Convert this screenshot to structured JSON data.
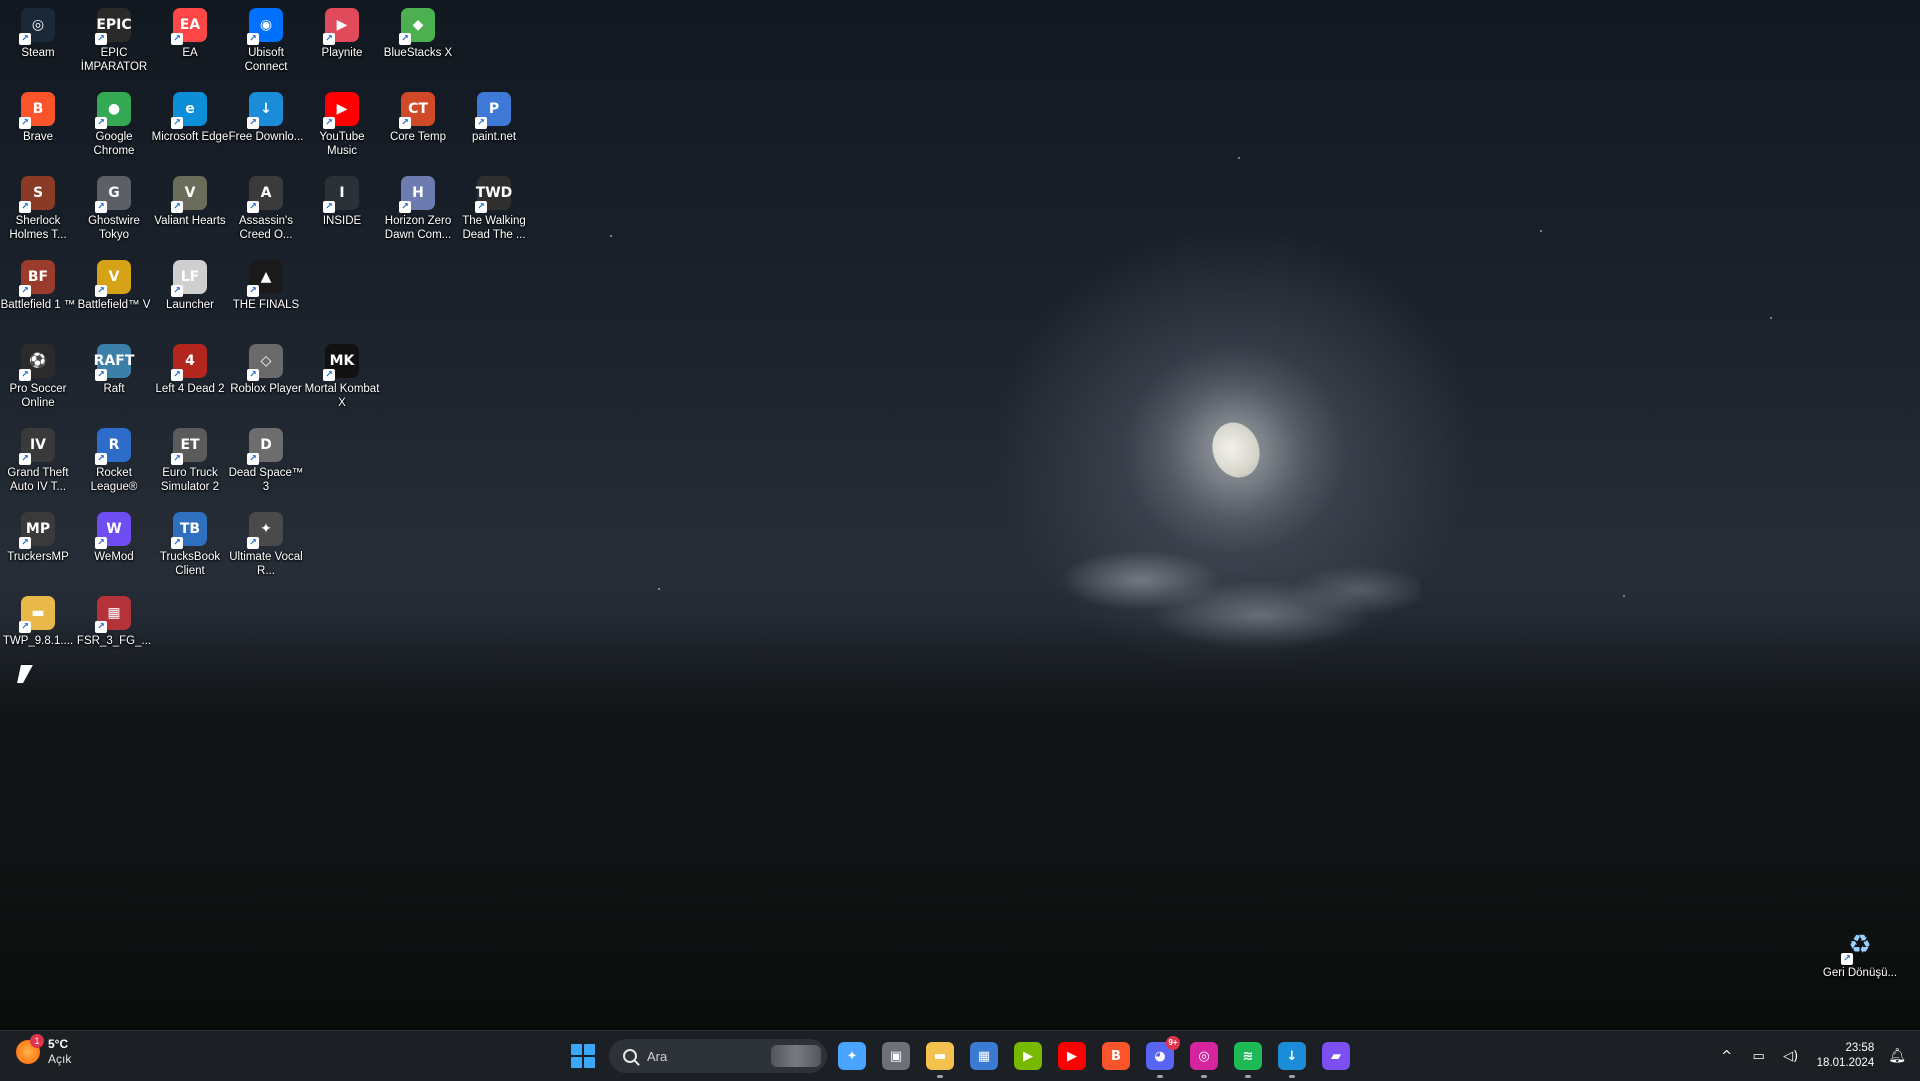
{
  "desktop": {
    "icons": [
      {
        "label": "Steam",
        "glyph": "◎",
        "color": "#1b2838"
      },
      {
        "label": "EPIC İMPARATOR",
        "glyph": "EPIC",
        "color": "#2a2a2a"
      },
      {
        "label": "EA",
        "glyph": "EA",
        "color": "#ff4747"
      },
      {
        "label": "Ubisoft Connect",
        "glyph": "◉",
        "color": "#0070ff"
      },
      {
        "label": "Playnite",
        "glyph": "▶",
        "color": "#e04a5a"
      },
      {
        "label": "BlueStacks X",
        "glyph": "◆",
        "color": "#4caf50"
      },
      {
        "label": "Brave",
        "glyph": "B",
        "color": "#fb542b"
      },
      {
        "label": "Google Chrome",
        "glyph": "●",
        "color": "#34a853"
      },
      {
        "label": "Microsoft Edge",
        "glyph": "e",
        "color": "#0c8fd6"
      },
      {
        "label": "Free Downlo...",
        "glyph": "↓",
        "color": "#1b8cd8"
      },
      {
        "label": "YouTube Music",
        "glyph": "▶",
        "color": "#ff0000"
      },
      {
        "label": "Core Temp",
        "glyph": "CT",
        "color": "#d04a2a"
      },
      {
        "label": "paint.net",
        "glyph": "P",
        "color": "#3f79d8"
      },
      {
        "label": "Sherlock Holmes T...",
        "glyph": "S",
        "color": "#8a3b25"
      },
      {
        "label": "Ghostwire Tokyo",
        "glyph": "G",
        "color": "#5c5f66"
      },
      {
        "label": "Valiant Hearts",
        "glyph": "V",
        "color": "#6b6d5a"
      },
      {
        "label": "Assassin's Creed O...",
        "glyph": "A",
        "color": "#3b3b3b"
      },
      {
        "label": "INSIDE",
        "glyph": "I",
        "color": "#2b3237"
      },
      {
        "label": "Horizon Zero Dawn Com...",
        "glyph": "H",
        "color": "#6d7bb0"
      },
      {
        "label": "The Walking Dead The ...",
        "glyph": "TWD",
        "color": "#2f2f2f"
      },
      {
        "label": "Battlefield 1 ™",
        "glyph": "BF",
        "color": "#9b3b2b"
      },
      {
        "label": "Battlefield™ V",
        "glyph": "V",
        "color": "#d6a318"
      },
      {
        "label": "Launcher",
        "glyph": "LF",
        "color": "#cfcfcf"
      },
      {
        "label": "THE FINALS",
        "glyph": "▲",
        "color": "#1a1a1a"
      },
      {
        "label": "Pro Soccer Online",
        "glyph": "⚽",
        "color": "#2b2b2b"
      },
      {
        "label": "Raft",
        "glyph": "RAFT",
        "color": "#3c7fa8"
      },
      {
        "label": "Left 4 Dead 2",
        "glyph": "4",
        "color": "#b3261e"
      },
      {
        "label": "Roblox Player",
        "glyph": "◇",
        "color": "#6a6a6a"
      },
      {
        "label": "Mortal Kombat X",
        "glyph": "MK",
        "color": "#111111"
      },
      {
        "label": "Grand Theft Auto IV T...",
        "glyph": "IV",
        "color": "#3a3a3a"
      },
      {
        "label": "Rocket League®",
        "glyph": "R",
        "color": "#2d6cc8"
      },
      {
        "label": "Euro Truck Simulator 2",
        "glyph": "ET",
        "color": "#5b5b5b"
      },
      {
        "label": "Dead Space™ 3",
        "glyph": "D",
        "color": "#6d6d6d"
      },
      {
        "label": "TruckersMP",
        "glyph": "MP",
        "color": "#3a3a3a"
      },
      {
        "label": "WeMod",
        "glyph": "W",
        "color": "#6e4ef2"
      },
      {
        "label": "TrucksBook Client",
        "glyph": "TB",
        "color": "#2f6fc0"
      },
      {
        "label": "Ultimate Vocal R...",
        "glyph": "✦",
        "color": "#4a4a4a"
      },
      {
        "label": "TWP_9.8.1....",
        "glyph": "▬",
        "color": "#e8b84a"
      },
      {
        "label": "FSR_3_FG_...",
        "glyph": "▦",
        "color": "#b4333b"
      }
    ],
    "recycle_bin": {
      "label": "Geri Dönüşü...",
      "glyph": "♻"
    }
  },
  "taskbar": {
    "weather": {
      "temp": "5°C",
      "condition": "Açık",
      "badge": "1"
    },
    "search_placeholder": "Ara",
    "apps": [
      {
        "name": "copilot",
        "glyph": "✦",
        "color": "#4aa3ff",
        "notif": ""
      },
      {
        "name": "task-view",
        "glyph": "▣",
        "color": "#6b7079",
        "notif": ""
      },
      {
        "name": "file-explorer",
        "glyph": "▬",
        "color": "#f2c14e",
        "notif": ""
      },
      {
        "name": "microsoft-store",
        "glyph": "▦",
        "color": "#3a7bd5",
        "notif": ""
      },
      {
        "name": "nvidia",
        "glyph": "▶",
        "color": "#76b900",
        "notif": ""
      },
      {
        "name": "youtube-music",
        "glyph": "▶",
        "color": "#ff0000",
        "notif": ""
      },
      {
        "name": "brave",
        "glyph": "B",
        "color": "#fb542b",
        "notif": ""
      },
      {
        "name": "discord",
        "glyph": "◕",
        "color": "#5865f2",
        "notif": "9+"
      },
      {
        "name": "instagram",
        "glyph": "◎",
        "color": "#d6249f",
        "notif": ""
      },
      {
        "name": "spotify",
        "glyph": "≋",
        "color": "#1db954",
        "notif": ""
      },
      {
        "name": "free-download-manager",
        "glyph": "↓",
        "color": "#1b8cd8",
        "notif": ""
      },
      {
        "name": "clipchamp",
        "glyph": "▰",
        "color": "#7b4ff0",
        "notif": ""
      }
    ],
    "tray": {
      "time": "23:58",
      "date": "18.01.2024"
    }
  }
}
